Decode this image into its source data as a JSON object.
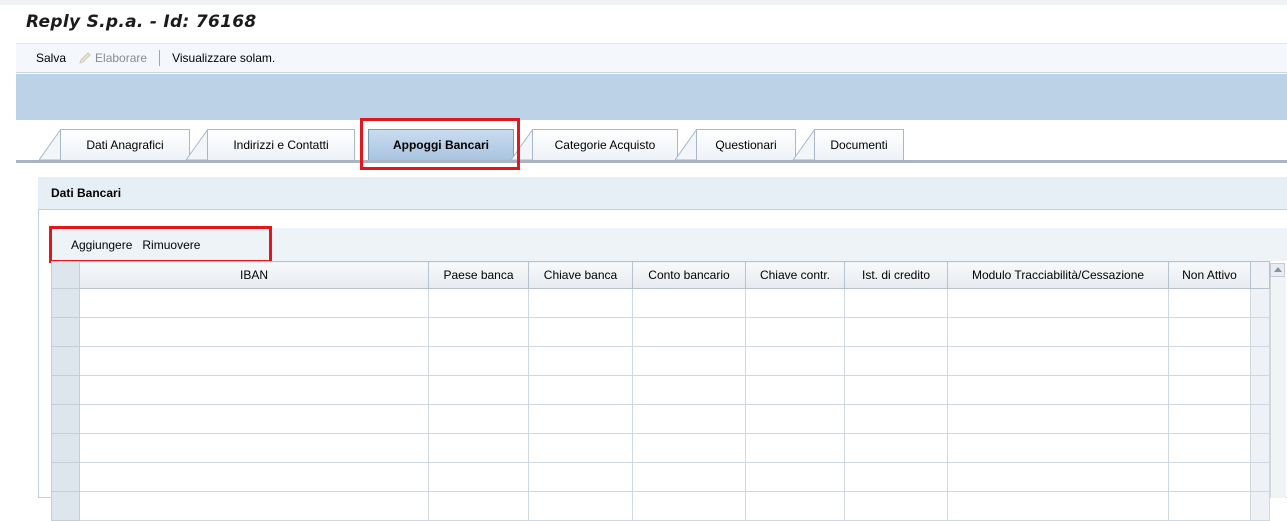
{
  "page": {
    "title": "Reply S.p.a. - Id: 76168"
  },
  "toolbar": {
    "save_label": "Salva",
    "edit_label": "Elaborare",
    "view_only_label": "Visualizzare solam."
  },
  "tabs": [
    {
      "label": "Dati Anagrafici",
      "active": false
    },
    {
      "label": "Indirizzi e Contatti",
      "active": false
    },
    {
      "label": "Appoggi Bancari",
      "active": true
    },
    {
      "label": "Categorie Acquisto",
      "active": false
    },
    {
      "label": "Questionari",
      "active": false
    },
    {
      "label": "Documenti",
      "active": false
    }
  ],
  "panel": {
    "title": "Dati Bancari"
  },
  "table_toolbar": {
    "add_label": "Aggiungere",
    "remove_label": "Rimuovere"
  },
  "table": {
    "columns": [
      "IBAN",
      "Paese banca",
      "Chiave banca",
      "Conto bancario",
      "Chiave contr.",
      "Ist. di credito",
      "Modulo Tracciabilità/Cessazione",
      "Non Attivo"
    ],
    "rows": [
      [
        "",
        "",
        "",
        "",
        "",
        "",
        "",
        ""
      ],
      [
        "",
        "",
        "",
        "",
        "",
        "",
        "",
        ""
      ],
      [
        "",
        "",
        "",
        "",
        "",
        "",
        "",
        ""
      ],
      [
        "",
        "",
        "",
        "",
        "",
        "",
        "",
        ""
      ],
      [
        "",
        "",
        "",
        "",
        "",
        "",
        "",
        ""
      ],
      [
        "",
        "",
        "",
        "",
        "",
        "",
        "",
        ""
      ],
      [
        "",
        "",
        "",
        "",
        "",
        "",
        "",
        ""
      ],
      [
        "",
        "",
        "",
        "",
        "",
        "",
        "",
        ""
      ]
    ]
  },
  "colors": {
    "accent_band": "#bcd2e6",
    "annotation": "#e3161e",
    "active_tab": "#a9c4e0"
  }
}
